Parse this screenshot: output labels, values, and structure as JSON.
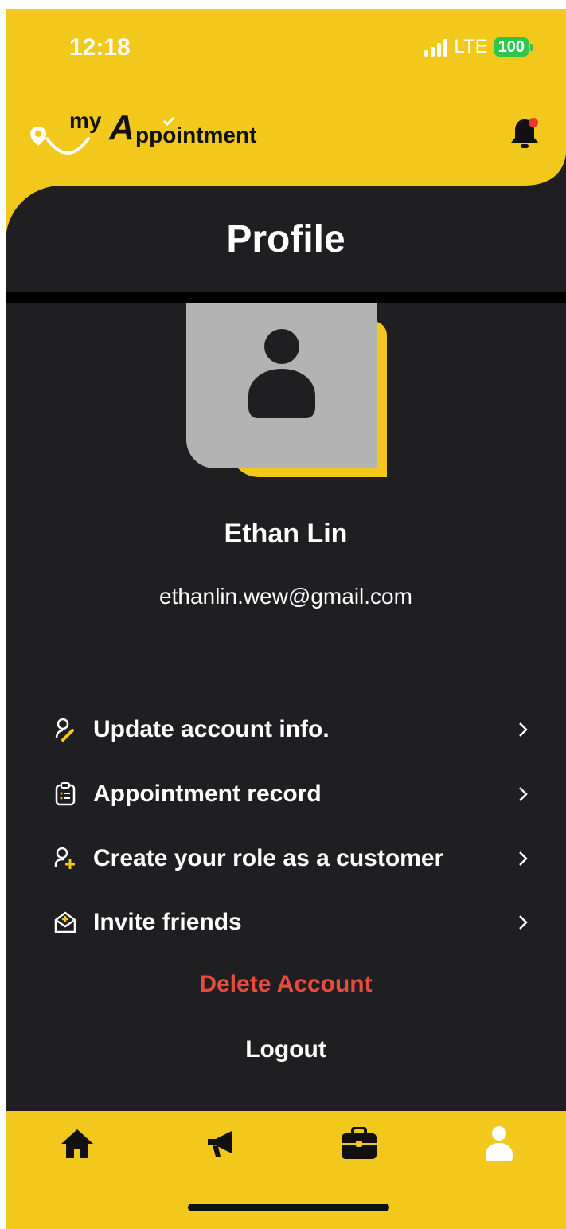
{
  "status_bar": {
    "time": "12:18",
    "network": "LTE",
    "battery": "100"
  },
  "header": {
    "logo": {
      "prefix": "my",
      "main": "A",
      "rest": "ppointment"
    }
  },
  "page": {
    "title": "Profile"
  },
  "user": {
    "name": "Ethan Lin",
    "email": "ethanlin.wew@gmail.com"
  },
  "menu": {
    "items": [
      {
        "label": "Update account info.",
        "icon": "user-edit-icon"
      },
      {
        "label": "Appointment record",
        "icon": "clipboard-list-icon"
      },
      {
        "label": "Create your role as a customer",
        "icon": "user-add-icon"
      },
      {
        "label": "Invite friends",
        "icon": "mail-plus-icon"
      }
    ],
    "delete_label": "Delete Account",
    "logout_label": "Logout"
  },
  "tab_bar": {
    "tabs": [
      {
        "name": "home",
        "icon": "home-icon"
      },
      {
        "name": "promotions",
        "icon": "megaphone-icon"
      },
      {
        "name": "business",
        "icon": "briefcase-icon"
      },
      {
        "name": "profile",
        "icon": "user-icon",
        "active": true
      }
    ]
  },
  "colors": {
    "brand_yellow": "#f2c81c",
    "dark_bg": "#1f1f21",
    "danger": "#e84a3e",
    "badge_red": "#e53935"
  }
}
